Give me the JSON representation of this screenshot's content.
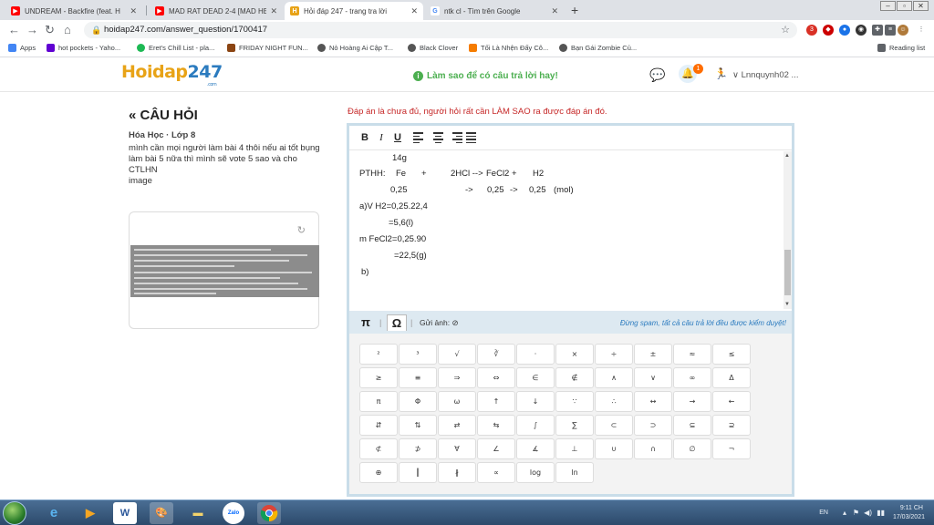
{
  "browser": {
    "tabs": [
      {
        "title": "UNDREAM - Backfire (feat. H",
        "icon": "youtube-icon"
      },
      {
        "title": "MAD RAT DEAD 2-4 [MAD HEAR",
        "icon": "youtube-icon"
      },
      {
        "title": "Hỏi đáp 247 - trang tra lời",
        "icon": "hoidap-icon"
      },
      {
        "title": "ntk cl - Tìm trên Google",
        "icon": "google-icon"
      }
    ],
    "url": "hoidap247.com/answer_question/1700417",
    "bookmarks": [
      "Apps",
      "hot pockets - Yaho...",
      "Eret's Chill List - pla...",
      "FRIDAY NIGHT FUN...",
      "Nỏ Hoàng Ai Cập T...",
      "Black Clover",
      "Tối Là Nhện Đấy Cô...",
      "Bạn Gái Zombie Củ..."
    ],
    "reading_list": "Reading list",
    "extension_badge": "3"
  },
  "header": {
    "logo_main": "Hoidap",
    "logo_num": "247",
    "logo_sub": ".com",
    "hint": "Làm sao để có câu trả lời hay!",
    "notification_count": "1",
    "username": "Lnnquynh02 ..."
  },
  "question": {
    "back_title": "« CÂU HỎI",
    "subject": "Hóa Học · Lớp 8",
    "text": "mình cần mọi người làm bài 4 thôi nếu ai tốt bụng làm bài 5 nữa thì mình sẽ vote 5 sao và cho CTLHN",
    "image_label": "image"
  },
  "answer": {
    "notice": "Đáp án là chưa đủ, người hỏi rất cần LÀM SAO ra được đáp án đó.",
    "toolbar": {
      "bold": "B",
      "italic": "I",
      "underline": "U"
    },
    "lines": {
      "l1": "14g",
      "l2_a": "PTHH:",
      "l2_b": "Fe",
      "l2_c": "+",
      "l2_d": "2HCl -->",
      "l2_e": "FeCl2 +",
      "l2_f": "H2",
      "l3_a": "0,25",
      "l3_b": "->",
      "l3_c": "0,25",
      "l3_d": "->",
      "l3_e": "0,25",
      "l3_f": "(mol)",
      "l4": "a)V H2=0,25.22,4",
      "l5": "=5,6(l)",
      "l6": "m FeCl2=0,25.90",
      "l7": "=22,5(g)",
      "l8": "b)"
    },
    "symbar": {
      "tab_pi": "π",
      "tab_omega": "Ω",
      "send_image": "Gửi ảnh:",
      "spam_notice": "Đừng spam, tất cả câu trả lời đều được kiểm duyệt!"
    },
    "symbols": [
      [
        "²",
        "³",
        "√",
        "∛",
        "·",
        "×",
        "÷",
        "±",
        "≈",
        "≤"
      ],
      [
        "≥",
        "≡",
        "⇒",
        "⇔",
        "∈",
        "∉",
        "∧",
        "∨",
        "∞",
        "Δ"
      ],
      [
        "π",
        "Φ",
        "ω",
        "↑",
        "↓",
        "∵",
        "∴",
        "↔",
        "→",
        "←"
      ],
      [
        "⇵",
        "⇅",
        "⇄",
        "⇆",
        "∫",
        "∑",
        "⊂",
        "⊃",
        "⊆",
        "⊇"
      ],
      [
        "⊄",
        "⊅",
        "∀",
        "∠",
        "∡",
        "⊥",
        "∪",
        "∩",
        "∅",
        "¬"
      ],
      [
        "⊕",
        "║",
        "∦",
        "∝",
        "log",
        "ln"
      ]
    ]
  },
  "taskbar": {
    "apps": [
      "start-button",
      "ie-icon",
      "media-player-icon",
      "word-icon",
      "paint-icon",
      "folder-icon",
      "zalo-icon",
      "chrome-icon"
    ],
    "zalo_label": "Zalo",
    "word_label": "W",
    "lang": "EN",
    "time": "9:11 CH",
    "date": "17/03/2021"
  },
  "colors": {
    "accent_blue": "#2b7bbf",
    "logo_orange": "#e8a317",
    "hint_green": "#4caf50",
    "notice_red": "#c62828",
    "editor_border": "#c9dde9"
  }
}
